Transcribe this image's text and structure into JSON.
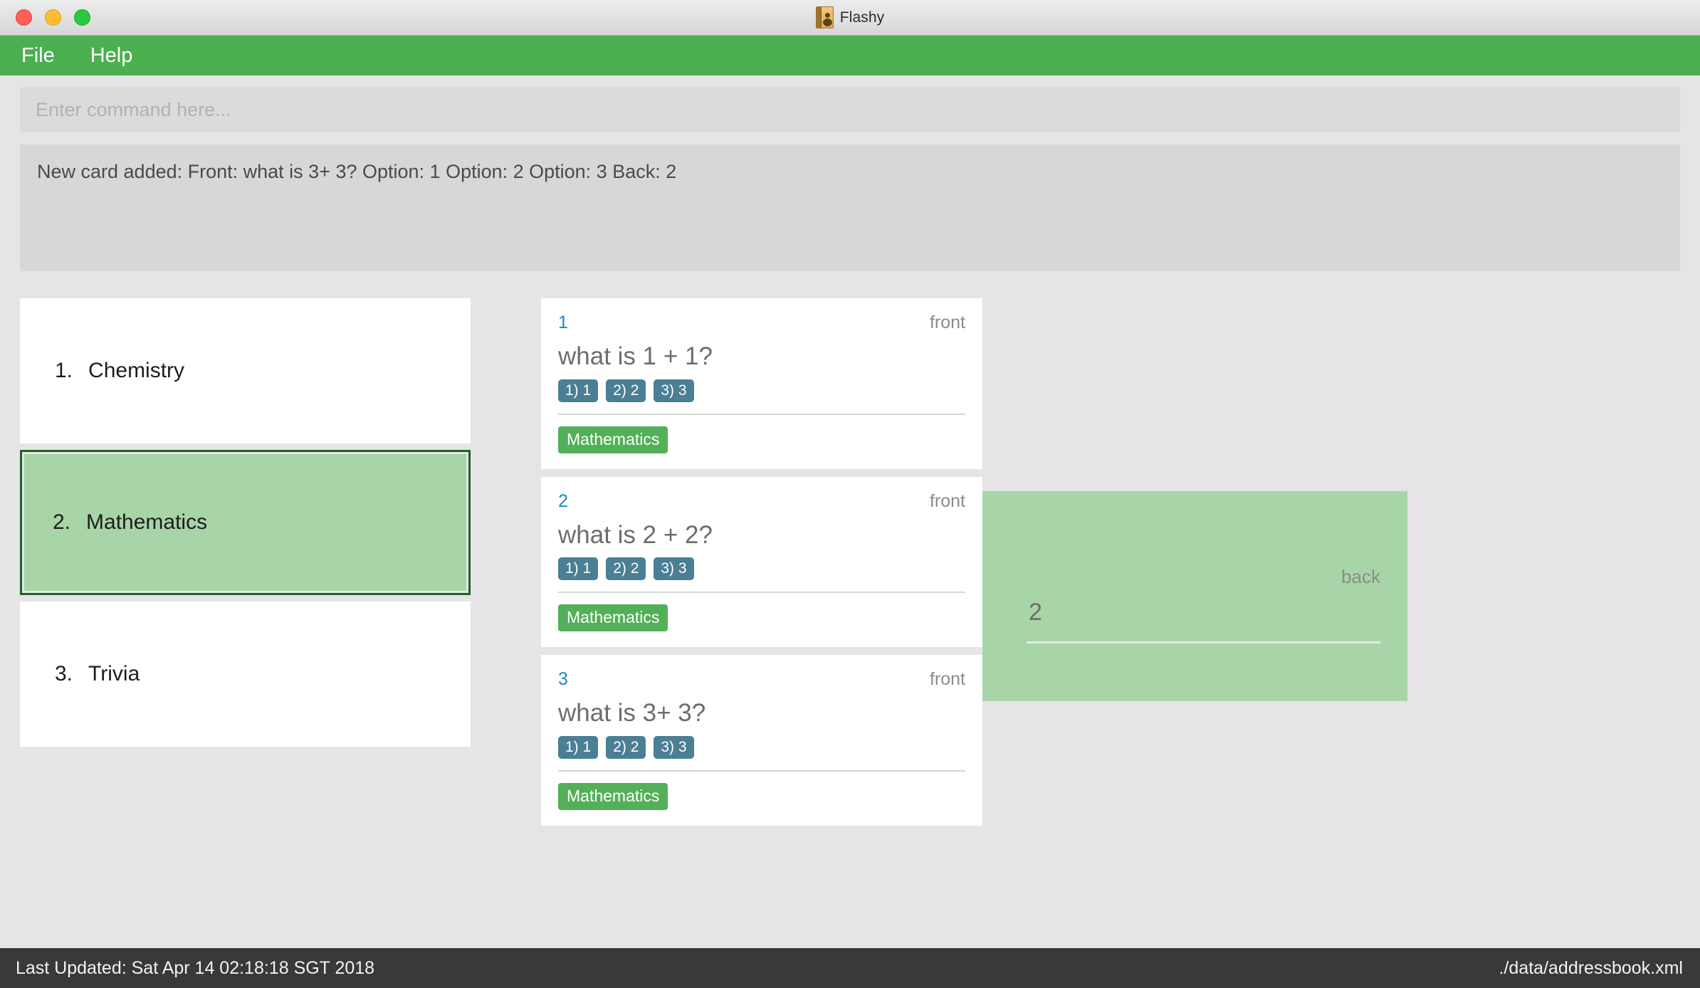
{
  "window": {
    "title": "Flashy",
    "app_icon": "address-book-icon",
    "controls": {
      "close": "close-window-button",
      "minimize": "minimize-window-button",
      "maximize": "maximize-window-button"
    }
  },
  "menubar": {
    "accent_color": "#4caf50",
    "items": [
      {
        "label": "File"
      },
      {
        "label": "Help"
      }
    ]
  },
  "command": {
    "value": "",
    "placeholder": "Enter command here..."
  },
  "result": {
    "message": "New card added: Front: what is 3+ 3? Option: 1 Option: 2 Option: 3 Back: 2"
  },
  "decks": {
    "selected_index": 1,
    "items": [
      {
        "index": "1.",
        "name": "Chemistry",
        "selected": false
      },
      {
        "index": "2.",
        "name": "Mathematics",
        "selected": true
      },
      {
        "index": "3.",
        "name": "Trivia",
        "selected": false
      }
    ]
  },
  "cards": [
    {
      "index": "1",
      "side": "front",
      "question": "what is 1 + 1?",
      "options": [
        "1) 1",
        "2) 2",
        "3) 3"
      ],
      "tag": "Mathematics"
    },
    {
      "index": "2",
      "side": "front",
      "question": "what is 2 + 2?",
      "options": [
        "1) 1",
        "2) 2",
        "3) 3"
      ],
      "tag": "Mathematics"
    },
    {
      "index": "3",
      "side": "front",
      "question": "what is 3+ 3?",
      "options": [
        "1) 1",
        "2) 2",
        "3) 3"
      ],
      "tag": "Mathematics"
    }
  ],
  "back_panel": {
    "side_label": "back",
    "value": "2",
    "background_color": "#a8d5a8"
  },
  "statusbar": {
    "last_updated": "Last Updated: Sat Apr 14 02:18:18 SGT 2018",
    "file_path": "./data/addressbook.xml"
  },
  "colors": {
    "accent_green": "#4caf50",
    "selected_green": "#a8d5a8",
    "selected_border": "#1e6323",
    "option_chip": "#4a7f95",
    "tag_green": "#53af58",
    "card_index_blue": "#1e88c7",
    "page_background": "#e6e4e7",
    "statusbar": "#393939"
  }
}
